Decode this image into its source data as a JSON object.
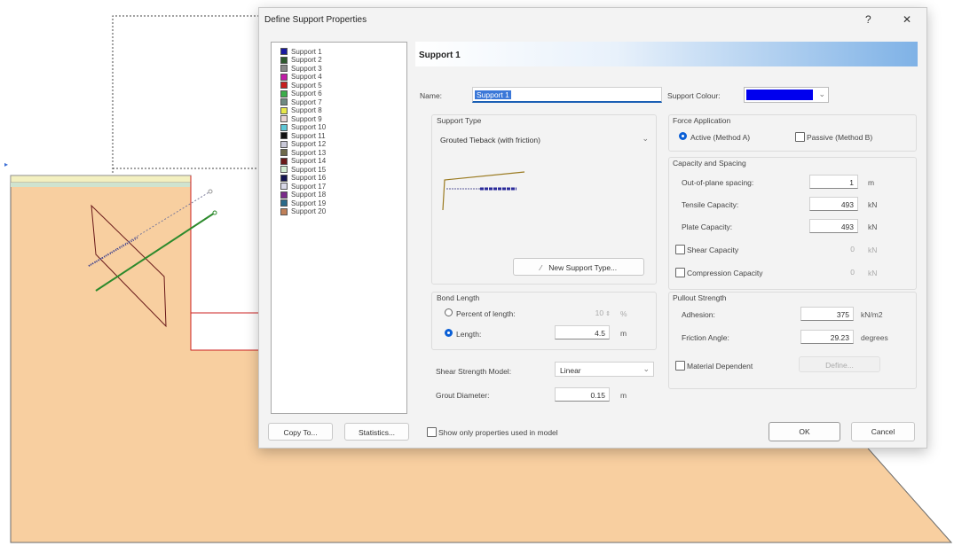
{
  "dialog": {
    "title": "Define Support Properties",
    "help_label": "?",
    "close_label": "✕",
    "header_title": "Support 1"
  },
  "supports": [
    {
      "label": "Support 1",
      "color": "#1a1aa0"
    },
    {
      "label": "Support 2",
      "color": "#2e5a2e"
    },
    {
      "label": "Support 3",
      "color": "#888888"
    },
    {
      "label": "Support 4",
      "color": "#c21ca8"
    },
    {
      "label": "Support 5",
      "color": "#c81e1e"
    },
    {
      "label": "Support 6",
      "color": "#3cae4a"
    },
    {
      "label": "Support 7",
      "color": "#6e8a82"
    },
    {
      "label": "Support 8",
      "color": "#e8e84a"
    },
    {
      "label": "Support 9",
      "color": "#e8d4d4"
    },
    {
      "label": "Support 10",
      "color": "#5ec6d6"
    },
    {
      "label": "Support 11",
      "color": "#111111"
    },
    {
      "label": "Support 12",
      "color": "#c8c8d8"
    },
    {
      "label": "Support 13",
      "color": "#6e6a4a"
    },
    {
      "label": "Support 14",
      "color": "#6a1a1a"
    },
    {
      "label": "Support 15",
      "color": "#d2ecd2"
    },
    {
      "label": "Support 16",
      "color": "#141450"
    },
    {
      "label": "Support 17",
      "color": "#d8d8e8"
    },
    {
      "label": "Support 18",
      "color": "#7a2a8a"
    },
    {
      "label": "Support 19",
      "color": "#2a6a8a"
    },
    {
      "label": "Support 20",
      "color": "#c08058"
    }
  ],
  "name": {
    "label": "Name:",
    "value": "Support 1"
  },
  "support_colour": {
    "label": "Support Colour:",
    "color": "#0000ee"
  },
  "support_type": {
    "group_label": "Support Type",
    "selected": "Grouted Tieback (with friction)",
    "new_button": "New Support Type..."
  },
  "force_application": {
    "group_label": "Force Application",
    "active_label": "Active (Method A)",
    "passive_label": "Passive (Method B)"
  },
  "capacity": {
    "group_label": "Capacity and Spacing",
    "rows": [
      {
        "label": "Out-of-plane spacing:",
        "value": "1",
        "unit": "m"
      },
      {
        "label": "Tensile Capacity:",
        "value": "493",
        "unit": "kN"
      },
      {
        "label": "Plate Capacity:",
        "value": "493",
        "unit": "kN"
      },
      {
        "label": "Shear Capacity",
        "value": "0",
        "unit": "kN"
      },
      {
        "label": "Compression Capacity",
        "value": "0",
        "unit": "kN"
      }
    ]
  },
  "bond_length": {
    "group_label": "Bond Length",
    "percent_label": "Percent of length:",
    "percent_value": "10",
    "percent_unit": "%",
    "length_label": "Length:",
    "length_value": "4.5",
    "length_unit": "m"
  },
  "pullout": {
    "group_label": "Pullout Strength",
    "adhesion_label": "Adhesion:",
    "adhesion_value": "375",
    "adhesion_unit": "kN/m2",
    "friction_label": "Friction Angle:",
    "friction_value": "29.23",
    "friction_unit": "degrees",
    "material_label": "Material Dependent",
    "define_button": "Define..."
  },
  "shear_model": {
    "label": "Shear Strength Model:",
    "value": "Linear"
  },
  "grout": {
    "label": "Grout Diameter:",
    "value": "0.15",
    "unit": "m"
  },
  "footer": {
    "copy_to": "Copy To...",
    "statistics": "Statistics...",
    "show_only": "Show only properties used in model",
    "ok": "OK",
    "cancel": "Cancel"
  }
}
